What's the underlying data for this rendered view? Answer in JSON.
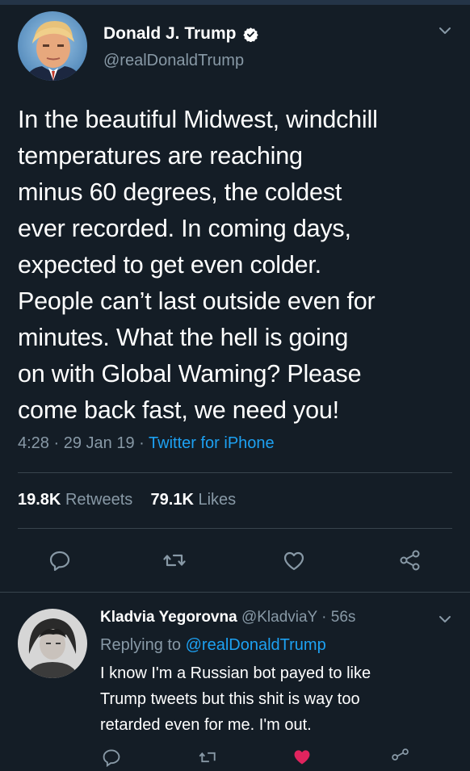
{
  "tweet": {
    "author_name": "Donald J. Trump",
    "author_handle": "@realDonaldTrump",
    "text": "In the beautiful Midwest, windchill\ntemperatures are reaching\nminus 60 degrees, the coldest\never recorded. In coming days,\nexpected to get even colder.\nPeople can’t last outside even for\nminutes. What the hell is going\non with Global Waming? Please\ncome back fast, we need you!",
    "time": "4:28",
    "date": "29 Jan 19",
    "separator": "·",
    "source": "Twitter for iPhone",
    "retweets_count": "19.8K",
    "retweets_label": "Retweets",
    "likes_count": "79.1K",
    "likes_label": "Likes"
  },
  "reply": {
    "author_name": "Kladvia Yegorovna",
    "author_handle": "@KladviaY",
    "time_ago": "56s",
    "replying_label": "Replying to",
    "replying_to": "@realDonaldTrump",
    "text": "I know I'm a Russian bot payed to  like\nTrump tweets but this shit is way too\nretarded even for me. I'm out."
  },
  "icons": {
    "verified": "verified-badge-icon",
    "reply": "reply-icon",
    "retweet": "retweet-icon",
    "like": "heart-icon",
    "share": "share-icon",
    "menu": "chevron-down-icon"
  },
  "colors": {
    "background": "#141d26",
    "accent": "#1da1f2",
    "secondary_text": "#8899a6",
    "like": "#e0245e"
  }
}
